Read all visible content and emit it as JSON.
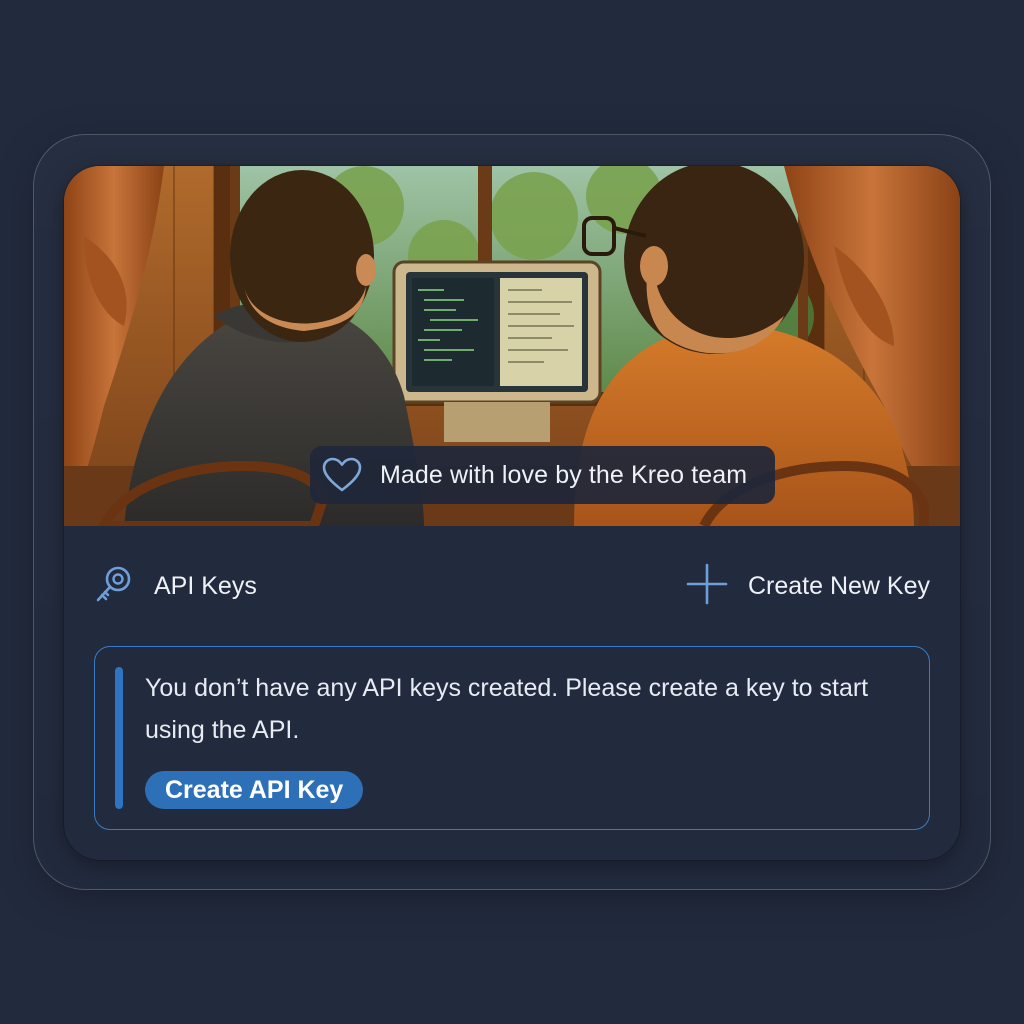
{
  "hero": {
    "badge_icon": "heart-icon",
    "badge_text": "Made with love by the Kreo team"
  },
  "section": {
    "icon": "key-icon",
    "title": "API Keys",
    "create_icon": "plus-icon",
    "create_label": "Create New Key"
  },
  "empty_state": {
    "message": "You don’t have any API keys created. Please create a key to start using the API.",
    "button_label": "Create API Key"
  },
  "colors": {
    "background": "#222b3e",
    "accent": "#2e70b8",
    "notice_border": "#3a7cc4",
    "icon_blue": "#6f9fd8",
    "text": "#eef1f6"
  }
}
